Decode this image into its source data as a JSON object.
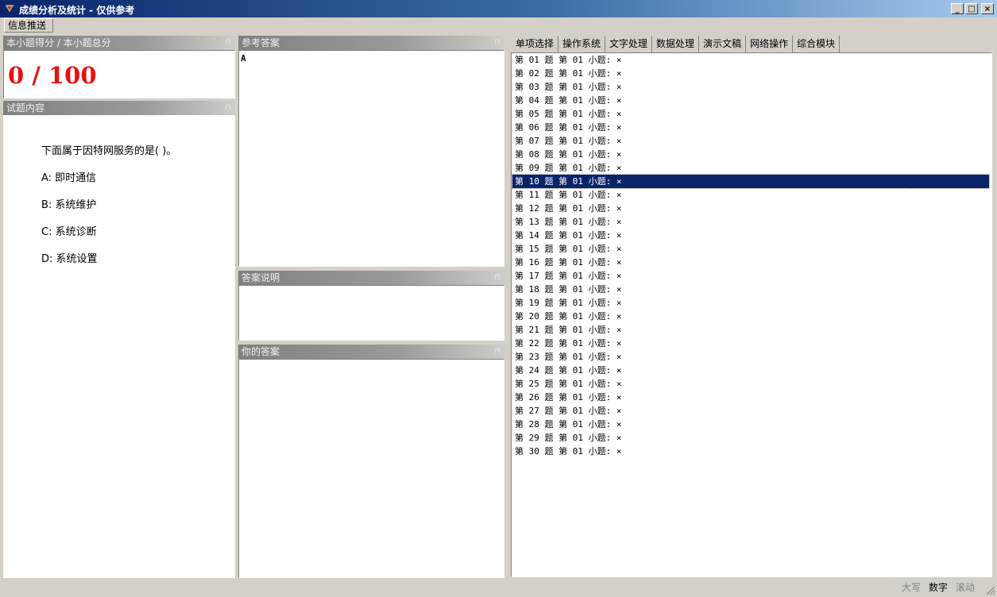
{
  "window": {
    "title": "成绩分析及统计 - 仅供参考",
    "controls": {
      "minimize": "_",
      "maximize": "□",
      "close": "×"
    }
  },
  "menu": {
    "info_push": "信息推送"
  },
  "score_pane": {
    "header": "本小题得分 / 本小题总分",
    "score_text": "0 / 100",
    "score_color": "#e8100e"
  },
  "question_pane": {
    "header": "试题内容",
    "stem": "下面属于因特网服务的是(  )。",
    "options": [
      "A: 即时通信",
      "B: 系统维护",
      "C: 系统诊断",
      "D: 系统设置"
    ]
  },
  "reference_pane": {
    "header": "参考答案",
    "answer": "A"
  },
  "explanation_pane": {
    "header": "答案说明",
    "text": ""
  },
  "your_answer_pane": {
    "header": "你的答案",
    "text": ""
  },
  "pin_icon": "⊓",
  "tabs": [
    "单项选择",
    "操作系统",
    "文字处理",
    "数据处理",
    "演示文稿",
    "网络操作",
    "综合模块"
  ],
  "active_tab_index": 0,
  "results": [
    "第 01 题 第 01 小题: ×",
    "第 02 题 第 01 小题: ×",
    "第 03 题 第 01 小题: ×",
    "第 04 题 第 01 小题: ×",
    "第 05 题 第 01 小题: ×",
    "第 06 题 第 01 小题: ×",
    "第 07 题 第 01 小题: ×",
    "第 08 题 第 01 小题: ×",
    "第 09 题 第 01 小题: ×",
    "第 10 题 第 01 小题: ×",
    "第 11 题 第 01 小题: ×",
    "第 12 题 第 01 小题: ×",
    "第 13 题 第 01 小题: ×",
    "第 14 题 第 01 小题: ×",
    "第 15 题 第 01 小题: ×",
    "第 16 题 第 01 小题: ×",
    "第 17 题 第 01 小题: ×",
    "第 18 题 第 01 小题: ×",
    "第 19 题 第 01 小题: ×",
    "第 20 题 第 01 小题: ×",
    "第 21 题 第 01 小题: ×",
    "第 22 题 第 01 小题: ×",
    "第 23 题 第 01 小题: ×",
    "第 24 题 第 01 小题: ×",
    "第 25 题 第 01 小题: ×",
    "第 26 题 第 01 小题: ×",
    "第 27 题 第 01 小题: ×",
    "第 28 题 第 01 小题: ×",
    "第 29 题 第 01 小题: ×",
    "第 30 题 第 01 小题: ×"
  ],
  "selected_result_index": 9,
  "status": {
    "caps": "大写",
    "num": "数字",
    "scroll": "滚动"
  }
}
